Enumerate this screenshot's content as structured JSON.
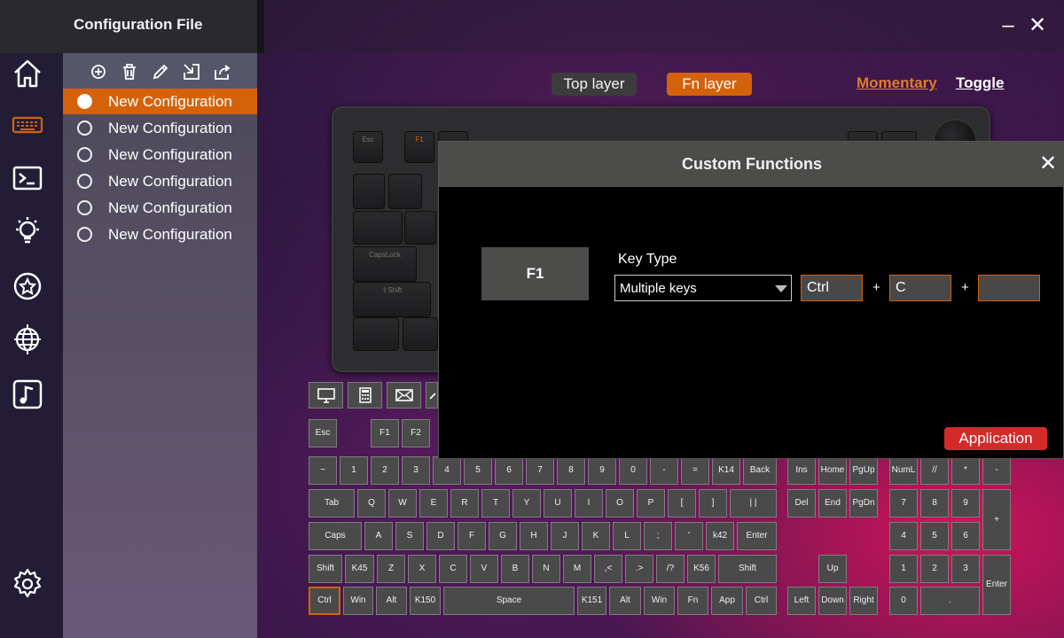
{
  "window": {
    "title": "Configuration File",
    "minimize_glyph": "–",
    "close_glyph": "✕"
  },
  "rail": {
    "icons": [
      "home-icon",
      "keyboard-icon",
      "terminal-icon",
      "lightbulb-icon",
      "star-badge-icon",
      "globe-icon",
      "music-icon",
      "settings-icon"
    ]
  },
  "config_toolbar": {
    "icons": [
      "add-icon",
      "trash-icon",
      "pencil-icon",
      "import-icon",
      "share-icon"
    ]
  },
  "configurations": [
    {
      "label": "New Configuration",
      "active": true
    },
    {
      "label": "New Configuration",
      "active": false
    },
    {
      "label": "New Configuration",
      "active": false
    },
    {
      "label": "New Configuration",
      "active": false
    },
    {
      "label": "New Configuration",
      "active": false
    },
    {
      "label": "New Configuration",
      "active": false
    }
  ],
  "layers": {
    "top": "Top layer",
    "fn": "Fn layer",
    "momentary": "Momentary",
    "toggle": "Toggle"
  },
  "colors": {
    "accent": "#d4620a",
    "apply": "#d42a2a"
  },
  "keyboard_image": {
    "labels": {
      "esc": "Esc",
      "f1": "F1",
      "caps": "CapsLock",
      "shift": "⇧Shift"
    }
  },
  "special_keys": [
    "monitor-icon",
    "calculator-icon",
    "mail-icon",
    "link-icon"
  ],
  "keys": {
    "esc": "Esc",
    "f1": "F1",
    "f2": "F2",
    "row1": [
      "~",
      "1",
      "2",
      "3",
      "4",
      "5",
      "6",
      "7",
      "8",
      "9",
      "0",
      "-",
      "=",
      "K14",
      "Back"
    ],
    "row2": [
      "Tab",
      "Q",
      "W",
      "E",
      "R",
      "T",
      "Y",
      "U",
      "I",
      "O",
      "P",
      "[",
      "]",
      "| |"
    ],
    "row3": [
      "Caps",
      "A",
      "S",
      "D",
      "F",
      "G",
      "H",
      "J",
      "K",
      "L",
      ";",
      "'",
      "k42",
      "Enter"
    ],
    "row4": [
      "Shift",
      "K45",
      "Z",
      "X",
      "C",
      "V",
      "B",
      "N",
      "M",
      ",<",
      ".>",
      "/?",
      "K56",
      "Shift"
    ],
    "row5": [
      "Ctrl",
      "Win",
      "Alt",
      "K150",
      "Space",
      "K151",
      "Alt",
      "Win",
      "Fn",
      "App",
      "Ctrl"
    ],
    "nav": [
      "Ins",
      "Home",
      "PgUp",
      "Del",
      "End",
      "PgDn",
      "Up",
      "Left",
      "Down",
      "Right"
    ],
    "numpad": [
      "NumL",
      "//",
      "*",
      "-",
      "7",
      "8",
      "9",
      "+",
      "4",
      "5",
      "6",
      "1",
      "2",
      "3",
      "Enter",
      "0",
      "."
    ]
  },
  "dialog": {
    "title": "Custom Functions",
    "close_glyph": "✕",
    "selected_key": "F1",
    "key_type_label": "Key Type",
    "key_type_value": "Multiple keys",
    "combo": [
      "Ctrl",
      "C",
      ""
    ],
    "plus": "+",
    "apply_label": "Application"
  }
}
